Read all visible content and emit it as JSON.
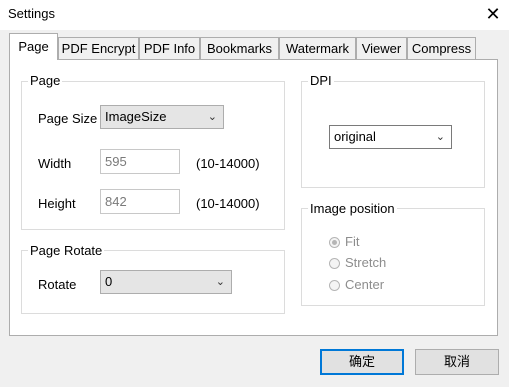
{
  "window": {
    "title": "Settings",
    "close_glyph": "✕"
  },
  "tabs": [
    {
      "label": "Page"
    },
    {
      "label": "PDF Encrypt"
    },
    {
      "label": "PDF Info"
    },
    {
      "label": "Bookmarks"
    },
    {
      "label": "Watermark"
    },
    {
      "label": "Viewer"
    },
    {
      "label": "Compress"
    }
  ],
  "page_group": {
    "legend": "Page",
    "page_size_label": "Page Size",
    "page_size_value": "ImageSize",
    "width_label": "Width",
    "width_value": "595",
    "width_range": "(10-14000)",
    "height_label": "Height",
    "height_value": "842",
    "height_range": "(10-14000)"
  },
  "rotate_group": {
    "legend": "Page Rotate",
    "rotate_label": "Rotate",
    "rotate_value": "0"
  },
  "dpi_group": {
    "legend": "DPI",
    "dpi_value": "original"
  },
  "image_position": {
    "legend": "Image position",
    "options": [
      "Fit",
      "Stretch",
      "Center"
    ],
    "selected": "Fit"
  },
  "buttons": {
    "ok": "确定",
    "cancel": "取消"
  },
  "icons": {
    "dropdown": "chevron-down-icon",
    "close": "close-icon"
  }
}
